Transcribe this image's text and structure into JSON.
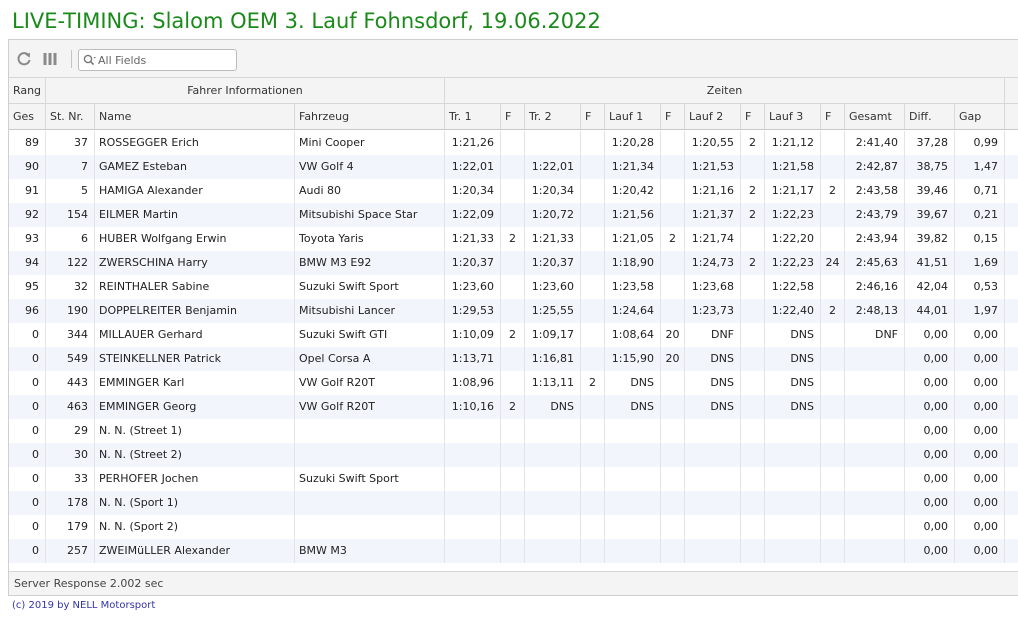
{
  "page": {
    "title": "LIVE-TIMING: Slalom OEM 3. Lauf Fohnsdorf, 19.06.2022",
    "copyright": "(c) 2019 by NELL Motorsport",
    "title_color": "#1a8a1a",
    "link_color": "#3333aa"
  },
  "toolbar": {
    "refresh_icon": "refresh-icon",
    "columns_icon": "columns-icon",
    "search_icon": "search-icon",
    "search_placeholder": "All Fields",
    "search_value": ""
  },
  "groups": {
    "rang": "Rang",
    "fahrer": "Fahrer Informationen",
    "zeiten": "Zeiten"
  },
  "columns": [
    "Ges",
    "St. Nr.",
    "Name",
    "Fahrzeug",
    "Tr. 1",
    "F",
    "Tr. 2",
    "F",
    "Lauf 1",
    "F",
    "Lauf 2",
    "F",
    "Lauf 3",
    "F",
    "Gesamt",
    "Diff.",
    "Gap"
  ],
  "rows": [
    [
      "89",
      "37",
      "ROSSEGGER Erich",
      "Mini Cooper",
      "1:21,26",
      "",
      "",
      "",
      "1:20,28",
      "",
      "1:20,55",
      "2",
      "1:21,12",
      "",
      "2:41,40",
      "37,28",
      "0,99"
    ],
    [
      "90",
      "7",
      "GAMEZ Esteban",
      "VW Golf 4",
      "1:22,01",
      "",
      "1:22,01",
      "",
      "1:21,34",
      "",
      "1:21,53",
      "",
      "1:21,58",
      "",
      "2:42,87",
      "38,75",
      "1,47"
    ],
    [
      "91",
      "5",
      "HAMIGA Alexander",
      "Audi 80",
      "1:20,34",
      "",
      "1:20,34",
      "",
      "1:20,42",
      "",
      "1:21,16",
      "2",
      "1:21,17",
      "2",
      "2:43,58",
      "39,46",
      "0,71"
    ],
    [
      "92",
      "154",
      "EILMER Martin",
      "Mitsubishi Space Star",
      "1:22,09",
      "",
      "1:20,72",
      "",
      "1:21,56",
      "",
      "1:21,37",
      "2",
      "1:22,23",
      "",
      "2:43,79",
      "39,67",
      "0,21"
    ],
    [
      "93",
      "6",
      "HUBER Wolfgang Erwin",
      "Toyota Yaris",
      "1:21,33",
      "2",
      "1:21,33",
      "",
      "1:21,05",
      "2",
      "1:21,74",
      "",
      "1:22,20",
      "",
      "2:43,94",
      "39,82",
      "0,15"
    ],
    [
      "94",
      "122",
      "ZWERSCHINA Harry",
      "BMW M3 E92",
      "1:20,37",
      "",
      "1:20,37",
      "",
      "1:18,90",
      "",
      "1:24,73",
      "2",
      "1:22,23",
      "24",
      "2:45,63",
      "41,51",
      "1,69"
    ],
    [
      "95",
      "32",
      "REINTHALER Sabine",
      "Suzuki Swift Sport",
      "1:23,60",
      "",
      "1:23,60",
      "",
      "1:23,58",
      "",
      "1:23,68",
      "",
      "1:22,58",
      "",
      "2:46,16",
      "42,04",
      "0,53"
    ],
    [
      "96",
      "190",
      "DOPPELREITER Benjamin",
      "Mitsubishi Lancer",
      "1:29,53",
      "",
      "1:25,55",
      "",
      "1:24,64",
      "",
      "1:23,73",
      "",
      "1:22,40",
      "2",
      "2:48,13",
      "44,01",
      "1,97"
    ],
    [
      "0",
      "344",
      "MILLAUER Gerhard",
      "Suzuki Swift GTI",
      "1:10,09",
      "2",
      "1:09,17",
      "",
      "1:08,64",
      "20",
      "DNF",
      "",
      "DNS",
      "",
      "DNF",
      "0,00",
      "0,00"
    ],
    [
      "0",
      "549",
      "STEINKELLNER Patrick",
      "Opel Corsa A",
      "1:13,71",
      "",
      "1:16,81",
      "",
      "1:15,90",
      "20",
      "DNS",
      "",
      "DNS",
      "",
      "",
      "0,00",
      "0,00"
    ],
    [
      "0",
      "443",
      "EMMINGER Karl",
      "VW Golf R20T",
      "1:08,96",
      "",
      "1:13,11",
      "2",
      "DNS",
      "",
      "DNS",
      "",
      "DNS",
      "",
      "",
      "0,00",
      "0,00"
    ],
    [
      "0",
      "463",
      "EMMINGER Georg",
      "VW Golf R20T",
      "1:10,16",
      "2",
      "DNS",
      "",
      "DNS",
      "",
      "DNS",
      "",
      "DNS",
      "",
      "",
      "0,00",
      "0,00"
    ],
    [
      "0",
      "29",
      "N. N. (Street 1)",
      "",
      "",
      "",
      "",
      "",
      "",
      "",
      "",
      "",
      "",
      "",
      "",
      "0,00",
      "0,00"
    ],
    [
      "0",
      "30",
      "N. N. (Street 2)",
      "",
      "",
      "",
      "",
      "",
      "",
      "",
      "",
      "",
      "",
      "",
      "",
      "0,00",
      "0,00"
    ],
    [
      "0",
      "33",
      "PERHOFER Jochen",
      "Suzuki Swift Sport",
      "",
      "",
      "",
      "",
      "",
      "",
      "",
      "",
      "",
      "",
      "",
      "0,00",
      "0,00"
    ],
    [
      "0",
      "178",
      "N. N. (Sport 1)",
      "",
      "",
      "",
      "",
      "",
      "",
      "",
      "",
      "",
      "",
      "",
      "",
      "0,00",
      "0,00"
    ],
    [
      "0",
      "179",
      "N. N. (Sport 2)",
      "",
      "",
      "",
      "",
      "",
      "",
      "",
      "",
      "",
      "",
      "",
      "",
      "0,00",
      "0,00"
    ],
    [
      "0",
      "257",
      "ZWEIMüLLER Alexander",
      "BMW M3",
      "",
      "",
      "",
      "",
      "",
      "",
      "",
      "",
      "",
      "",
      "",
      "0,00",
      "0,00"
    ]
  ],
  "footer": {
    "status": "Server Response 2.002 sec"
  }
}
